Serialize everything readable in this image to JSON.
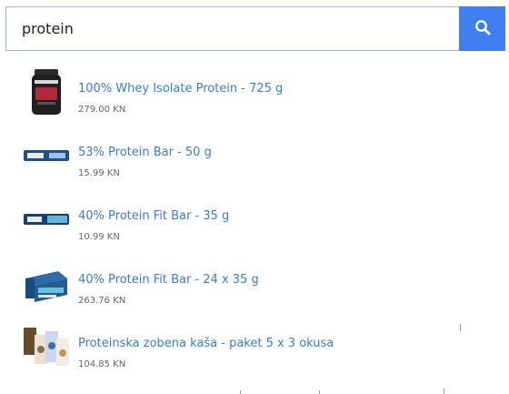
{
  "search": {
    "value": "protein",
    "button_icon": "search-icon"
  },
  "colors": {
    "accent": "#3f7ff2",
    "link": "#3a7bd5",
    "price": "#666666",
    "input_border": "#8fb7ea"
  },
  "results": [
    {
      "name": "100% Whey Isolate Protein - 725 g",
      "price": "279.00 KN",
      "image": "protein-tub-image"
    },
    {
      "name": "53% Protein Bar - 50 g",
      "price": "15.99 KN",
      "image": "protein-bar-image"
    },
    {
      "name": "40% Protein Fit Bar - 35 g",
      "price": "10.99 KN",
      "image": "fit-bar-image"
    },
    {
      "name": "40% Protein Fit Bar - 24 x 35 g",
      "price": "263.76 KN",
      "image": "fit-bar-box-image"
    },
    {
      "name": "Proteinska zobena kaša - paket 5 x 3 okusa",
      "price": "104.85 KN",
      "image": "oat-pack-image"
    }
  ]
}
